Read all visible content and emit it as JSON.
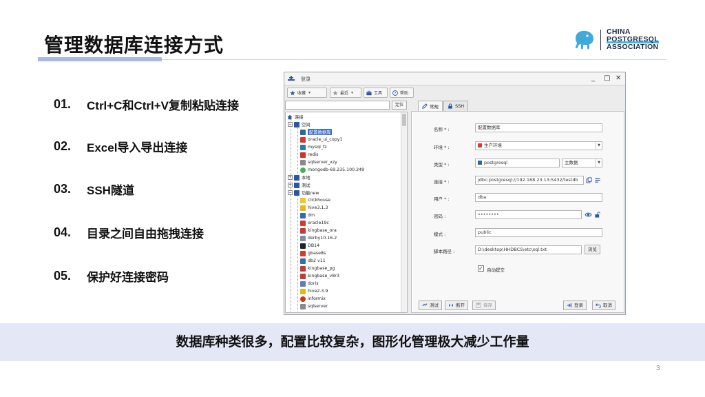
{
  "slide": {
    "title": "管理数据库连接方式",
    "page_number": "3",
    "banner": "数据库种类很多，配置比较复杂，图形化管理极大减少工作量"
  },
  "logo": {
    "line1": "CHINA",
    "line2": "POSTGRESQL",
    "line3": "ASSOCIATION",
    "accent": "#3fb9e8",
    "elephant": "#3fa9dc"
  },
  "features": [
    {
      "num": "01.",
      "text": "Ctrl+C和Ctrl+V复制粘贴连接"
    },
    {
      "num": "02.",
      "text": "Excel导入导出连接"
    },
    {
      "num": "03.",
      "text": "SSH隧道"
    },
    {
      "num": "04.",
      "text": "目录之间自由拖拽连接"
    },
    {
      "num": "05.",
      "text": "保护好连接密码"
    }
  ],
  "window": {
    "title": "登录",
    "controls": {
      "minimize": "_",
      "maximize": "□",
      "close": "✕"
    },
    "toolbar": {
      "favorites": "收藏",
      "history": "最近",
      "tools": "工具",
      "help": "帮助"
    },
    "search": {
      "placeholder": "",
      "button": "定位"
    },
    "tree": {
      "root": "连接",
      "nodes": [
        {
          "label": "空间",
          "type": "folder"
        },
        {
          "label": "配置数据库",
          "type": "postgres"
        },
        {
          "label": "oracle_ui_copy1",
          "type": "oracle"
        },
        {
          "label": "mysql_fz",
          "type": "mysql"
        },
        {
          "label": "redis",
          "type": "redis"
        },
        {
          "label": "sqlserver_xzy",
          "type": "sqlserver"
        },
        {
          "label": "mongodb-69.235.100.249",
          "type": "mongodb"
        },
        {
          "label": "本地",
          "type": "folder"
        },
        {
          "label": "测试",
          "type": "folder"
        },
        {
          "label": "功能new",
          "type": "folder"
        },
        {
          "label": "clickhouse",
          "type": "clickhouse"
        },
        {
          "label": "hive3.1.3",
          "type": "hive"
        },
        {
          "label": "dm",
          "type": "dm"
        },
        {
          "label": "oracle19c",
          "type": "oracle"
        },
        {
          "label": "kingbase_ora",
          "type": "kingbase"
        },
        {
          "label": "derby10.16.2",
          "type": "derby"
        },
        {
          "label": "DB14",
          "type": "db"
        },
        {
          "label": "gbase8s",
          "type": "gbase"
        },
        {
          "label": "db2 v11",
          "type": "db2"
        },
        {
          "label": "kingbase_pg",
          "type": "kingbase"
        },
        {
          "label": "kingbase_v8r3",
          "type": "kingbase"
        },
        {
          "label": "doris",
          "type": "doris"
        },
        {
          "label": "hive2.3.9",
          "type": "hive"
        },
        {
          "label": "informix",
          "type": "informix"
        },
        {
          "label": "sqlserver",
          "type": "sqlserver"
        }
      ]
    },
    "tabs": {
      "general": "常规",
      "ssh": "SSH"
    },
    "form": {
      "name_label": "名称 * :",
      "name_value": "配置数据库",
      "env_label": "环境 * :",
      "env_value": "生产环境",
      "type_label": "类型 * :",
      "type_value": "postgresql",
      "type_mode": "主数据",
      "url_label": "连接 * :",
      "url_value": "jdbc:postgresql://192.168.23.13:5432/testdb",
      "user_label": "用户 * :",
      "user_value": "dba",
      "password_label": "密码 :",
      "password_value": "••••••••",
      "schema_label": "模式 :",
      "schema_value": "public",
      "script_label": "脚本路径 :",
      "script_value": "D:\\desktop\\HHDBCS\\etc\\sql.txt",
      "browse_label": "浏览",
      "autocommit_label": "自动提交",
      "autocommit_checked": "✓"
    },
    "buttons": {
      "test": "测试",
      "disconnect": "断开",
      "save": "保存",
      "login": "登录",
      "cancel": "取消"
    }
  },
  "colors": {
    "accent_bar": "#aab8e8",
    "banner_bg": "#e3e7f6",
    "tree_selection": "#3b6fd0"
  }
}
